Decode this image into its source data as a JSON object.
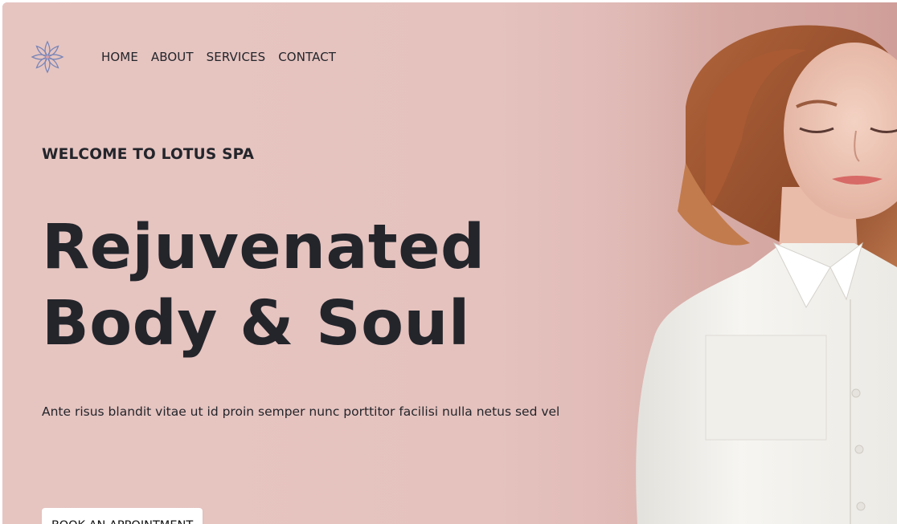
{
  "brand": {
    "logo_icon": "lotus-flower-icon",
    "logo_color": "#7a86b8"
  },
  "nav": {
    "items": [
      {
        "label": "HOME"
      },
      {
        "label": "ABOUT"
      },
      {
        "label": "SERVICES"
      },
      {
        "label": "CONTACT"
      }
    ]
  },
  "hero": {
    "eyebrow": "WELCOME TO LOTUS SPA",
    "headline_line1": "Rejuvenated",
    "headline_line2": "Body & Soul",
    "lede": "Ante risus blandit vitae ut id proin semper nunc porttitor facilisi nulla netus sed vel",
    "cta_label": "BOOK AN APPOINTMENT",
    "photo_icon": "woman-portrait-photo",
    "background_color": "#e5c3bf",
    "text_color": "#23252b"
  }
}
